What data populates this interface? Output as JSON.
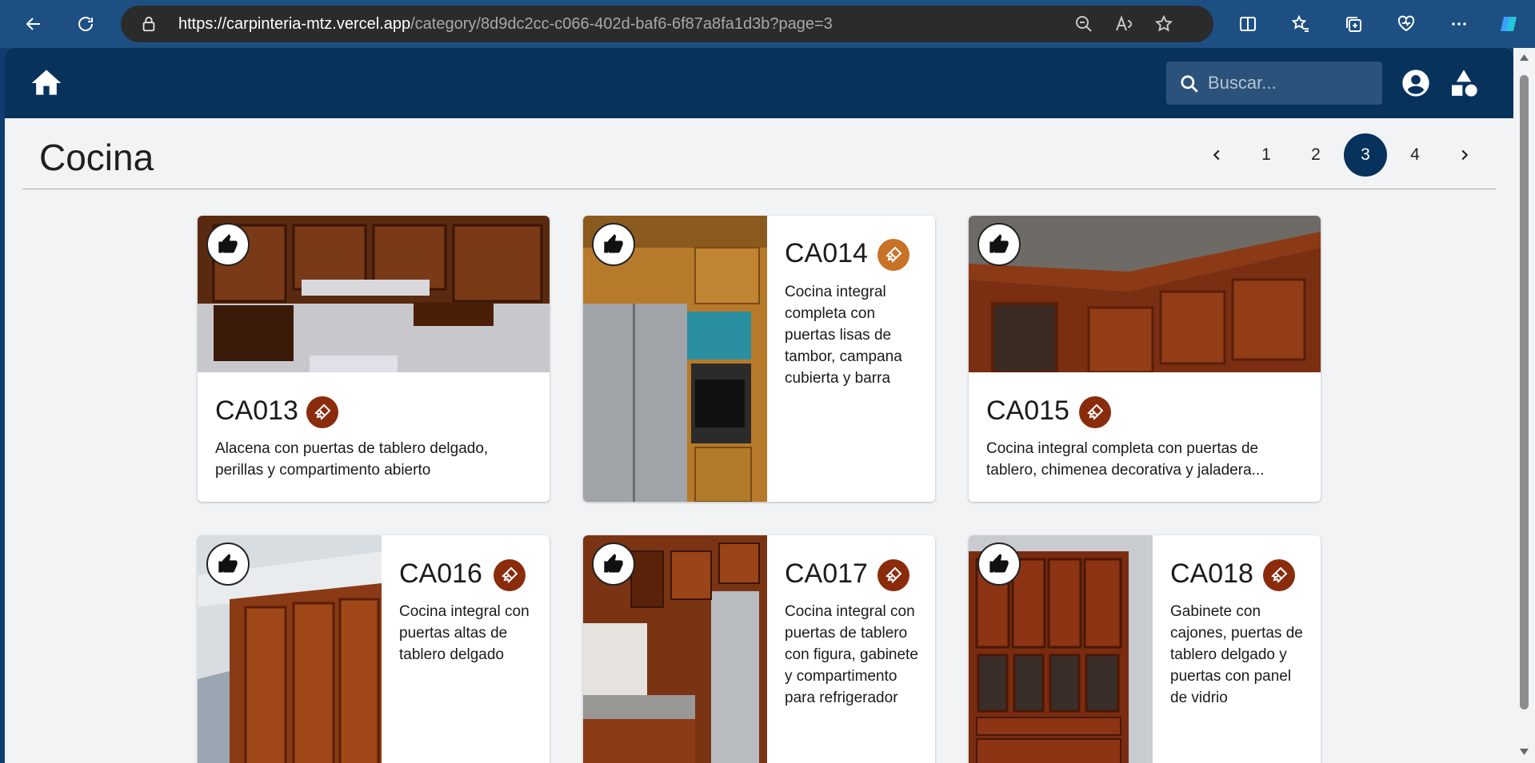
{
  "browser": {
    "url_host": "https://carpinteria-mtz.vercel.app",
    "url_path": "/category/8d9dc2cc-c066-402d-baf6-6f87a8fa1d3b?page=3"
  },
  "navbar": {
    "search_placeholder": "Buscar..."
  },
  "page": {
    "title": "Cocina"
  },
  "pagination": {
    "pages": [
      "1",
      "2",
      "3",
      "4"
    ],
    "current": "3"
  },
  "cards": [
    {
      "code": "CA013",
      "description": "Alacena con puertas de tablero delgado, perillas y compartimento abierto"
    },
    {
      "code": "CA014",
      "description": "Cocina integral completa con puertas lisas de tambor, campana cubierta y barra"
    },
    {
      "code": "CA015",
      "description": "Cocina integral completa con puertas de tablero, chimenea decorativa y jaladera..."
    },
    {
      "code": "CA016",
      "description": "Cocina integral con puertas altas de tablero delgado"
    },
    {
      "code": "CA017",
      "description": "Cocina integral con puertas de tablero con figura, gabinete y compartimento para refrigerador"
    },
    {
      "code": "CA018",
      "description": "Gabinete con cajones, puertas de tablero delgado y puertas con panel de vidrio"
    }
  ],
  "colors": {
    "navbar": "#06325c",
    "accent_badge": "#8a2c0c",
    "accent_badge_alt": "#c87227",
    "page_bg": "#f2f3f5"
  }
}
